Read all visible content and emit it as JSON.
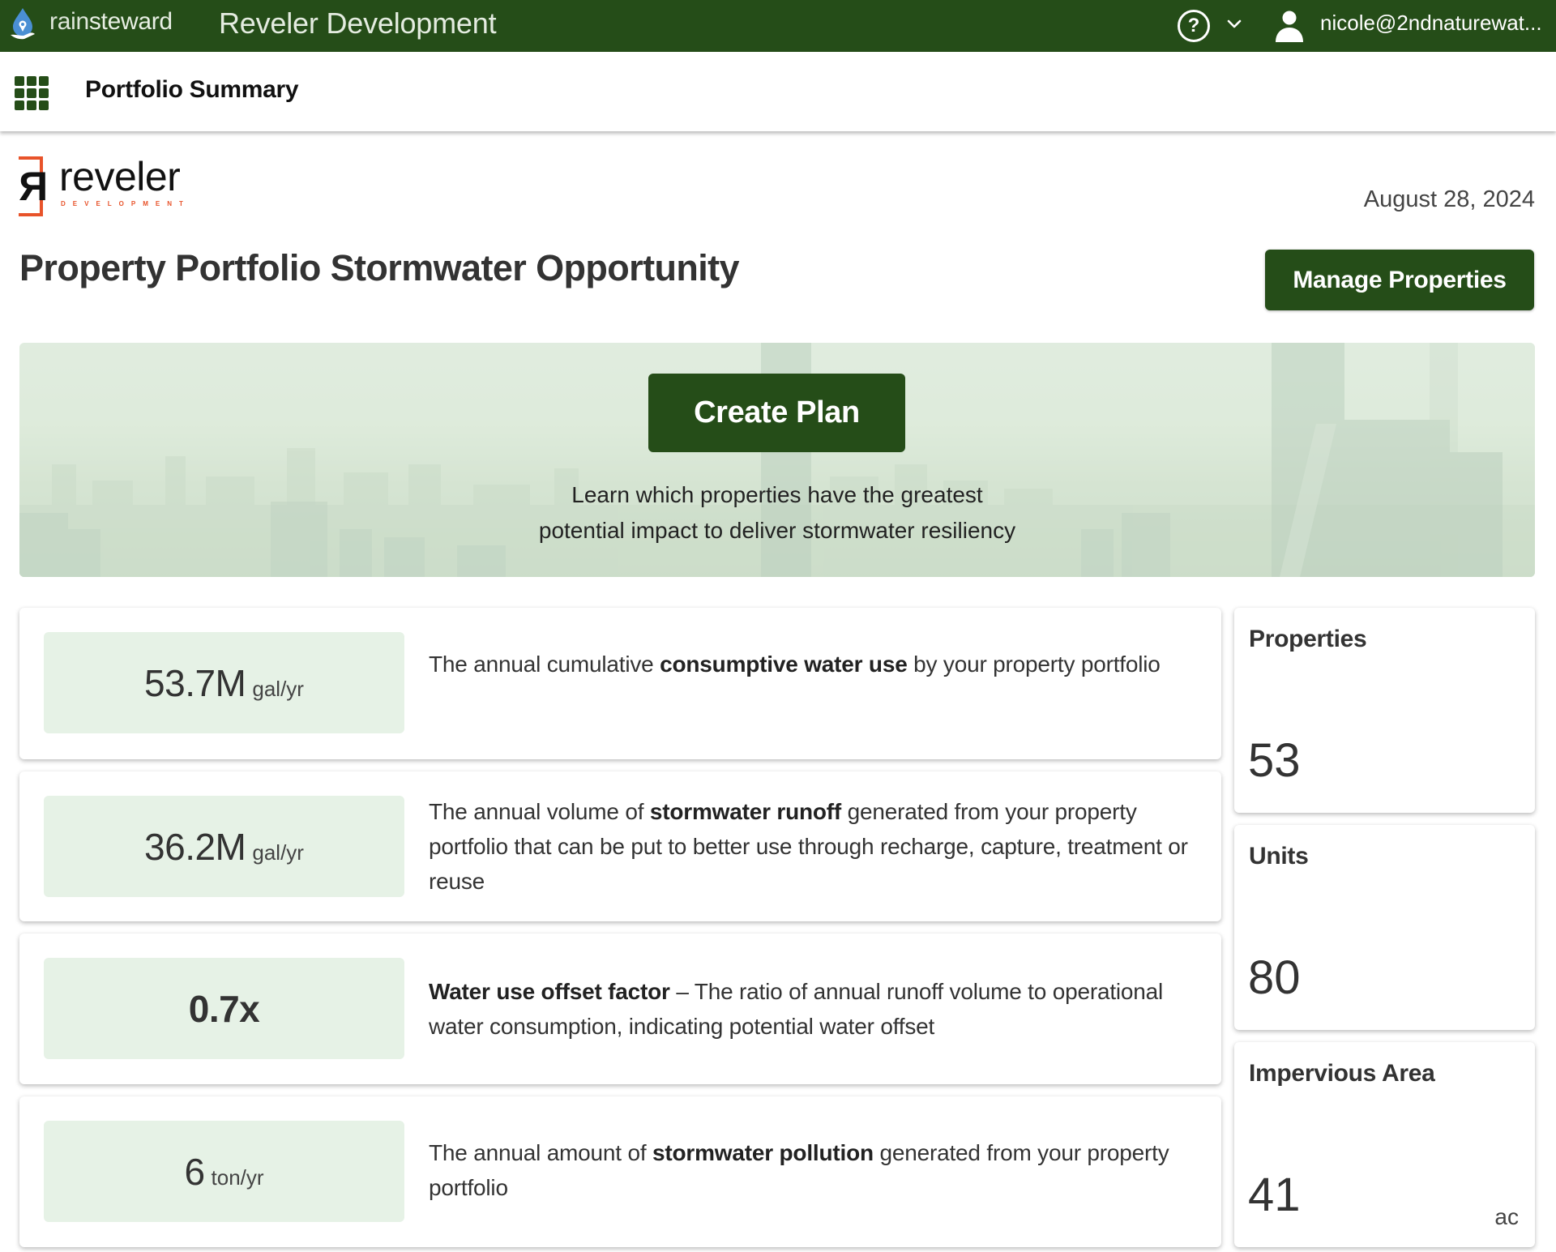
{
  "topbar": {
    "brand_light": "rain",
    "brand_bold": "steward",
    "org_name": "Reveler Development",
    "help_label": "?",
    "user_email": "nicole@2ndnaturewat...",
    "icons": {
      "brand": "water-drop-hand-icon",
      "help": "help-circle-icon",
      "menu": "chevron-down-icon",
      "user": "user-icon"
    }
  },
  "subheader": {
    "apps_icon": "apps-grid-icon",
    "page_name": "Portfolio Summary"
  },
  "logo": {
    "word": "reveler",
    "sub": "DEVELOPMENT",
    "mark": "R"
  },
  "header": {
    "date": "August 28, 2024",
    "title": "Property Portfolio Stormwater Opportunity",
    "manage_button": "Manage Properties"
  },
  "banner": {
    "create_button": "Create Plan",
    "text_line1": "Learn which properties have the greatest",
    "text_line2": "potential impact to deliver stormwater resiliency"
  },
  "metrics": [
    {
      "value": "53.7M",
      "unit": "gal/yr",
      "desc_pre": "The annual cumulative ",
      "desc_bold": "consumptive water use",
      "desc_post": " by your property portfolio"
    },
    {
      "value": "36.2M",
      "unit": "gal/yr",
      "desc_pre": "The annual volume of ",
      "desc_bold": "stormwater runoff",
      "desc_post": " generated from your property portfolio that can be put to better use through recharge, capture, treatment or reuse"
    },
    {
      "value": "0.7x",
      "unit": "",
      "desc_pre": "",
      "desc_bold": "Water use offset factor",
      "desc_post": " – The ratio of annual runoff volume to operational water consumption, indicating potential water offset"
    },
    {
      "value": "6",
      "unit": "ton/yr",
      "desc_pre": "The annual amount of ",
      "desc_bold": "stormwater pollution",
      "desc_post": " generated from your property portfolio"
    }
  ],
  "stats": [
    {
      "label": "Properties",
      "value": "53",
      "unit": ""
    },
    {
      "label": "Units",
      "value": "80",
      "unit": ""
    },
    {
      "label": "Impervious Area",
      "value": "41",
      "unit": "ac"
    }
  ],
  "colors": {
    "brand_green": "#254d18",
    "metric_bg": "#e6f2e6",
    "logo_orange": "#e8532a",
    "brand_drop_blue": "#4a8fd4"
  }
}
